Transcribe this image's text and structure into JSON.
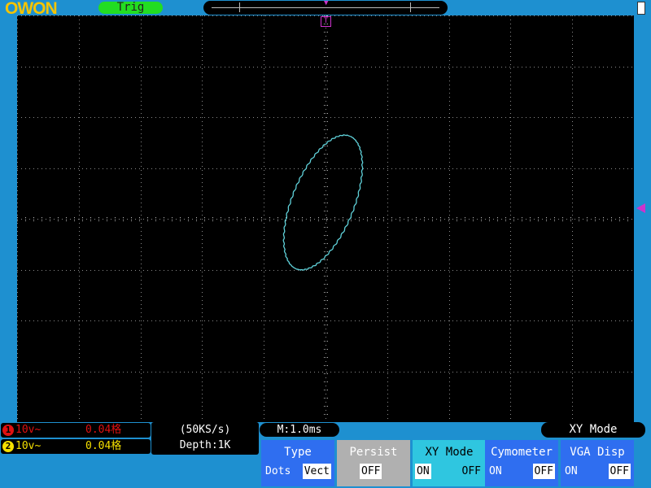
{
  "header": {
    "logo": "OWON",
    "trigger_status": "Trig",
    "trigger_position_marker": "T",
    "colors": {
      "logo": "#f5c400",
      "trig_bg": "#22dd22",
      "trigger_marker": "#cc33cc"
    }
  },
  "screen": {
    "grid_divisions": {
      "horizontal": 10,
      "vertical": 8
    },
    "trace_color": "#5fd0d8",
    "trigger_level_marker": "◀"
  },
  "channels": [
    {
      "number": "1",
      "volts": "10v~",
      "position": "0.04格",
      "color": "#e01010"
    },
    {
      "number": "2",
      "volts": "10v~",
      "position": "0.04格",
      "color": "#f5e000"
    }
  ],
  "acquisition": {
    "sample_rate": "(50KS/s)",
    "depth": "Depth:1K",
    "timebase": "M:1.0ms"
  },
  "menu": {
    "title": "XY Mode",
    "softkeys": [
      {
        "label": "Type",
        "options": [
          "Dots",
          "Vect"
        ],
        "selected": "Vect",
        "color": "#2f6ef0",
        "text_color": "#ffffff"
      },
      {
        "label": "Persist",
        "options": [
          "OFF"
        ],
        "selected": "OFF",
        "color": "#b0b0b0",
        "text_color": "#ffffff"
      },
      {
        "label": "XY Mode",
        "options": [
          "ON",
          "OFF"
        ],
        "selected": "ON",
        "color": "#2fc6e0",
        "text_color": "#000000"
      },
      {
        "label": "Cymometer",
        "options": [
          "ON",
          "OFF"
        ],
        "selected": "OFF",
        "color": "#2f6ef0",
        "text_color": "#ffffff"
      },
      {
        "label": "VGA Disp",
        "options": [
          "ON",
          "OFF"
        ],
        "selected": "OFF",
        "color": "#2f6ef0",
        "text_color": "#ffffff"
      }
    ]
  }
}
